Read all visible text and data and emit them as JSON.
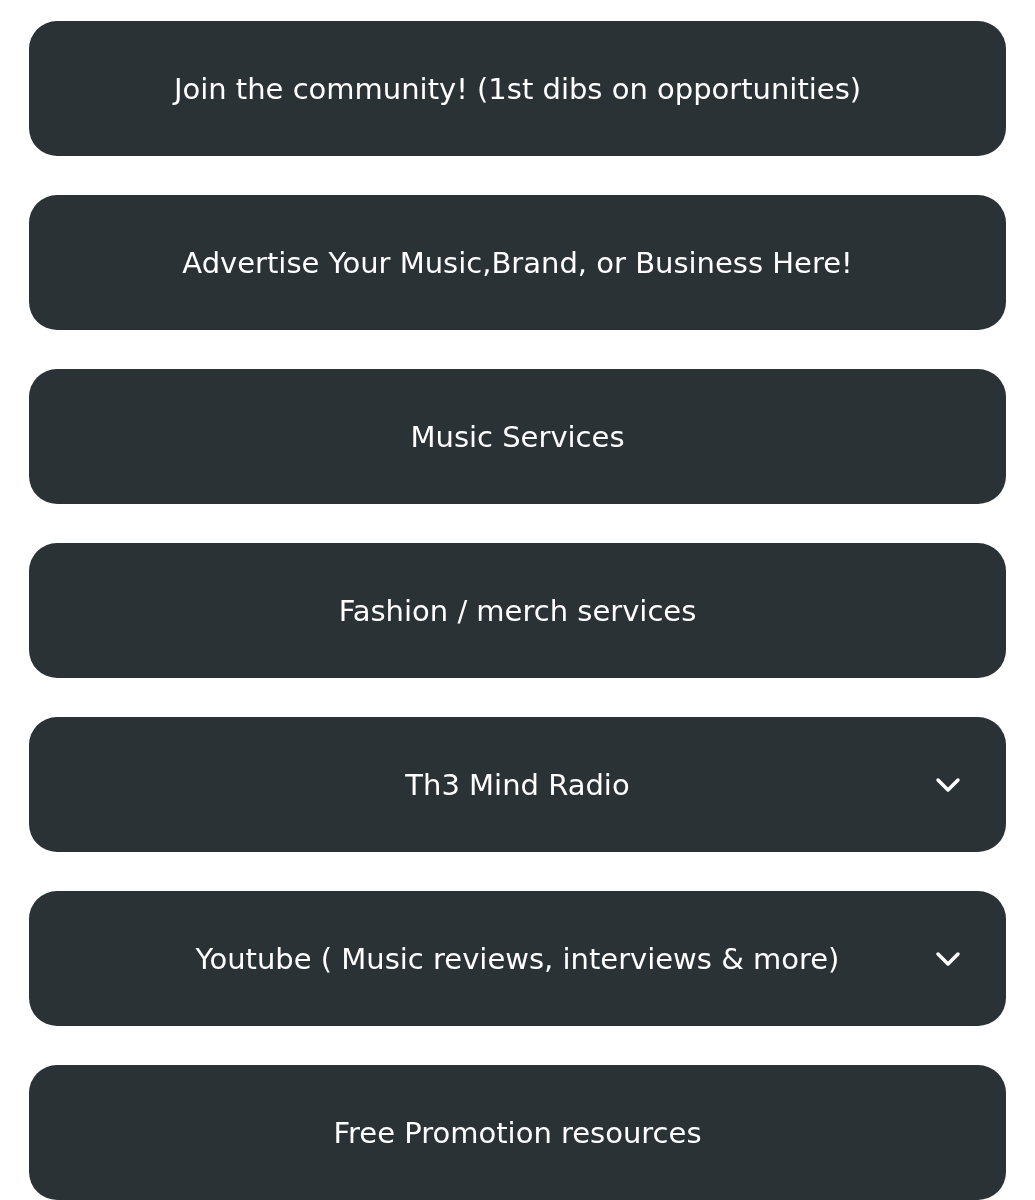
{
  "links": [
    {
      "label": "Join the community! (1st dibs on opportunities)",
      "kind": "link"
    },
    {
      "label": "Advertise Your Music,Brand, or Business Here!",
      "kind": "link"
    },
    {
      "label": "Music Services",
      "kind": "link"
    },
    {
      "label": "Fashion / merch services",
      "kind": "link"
    },
    {
      "label": "Th3 Mind Radio",
      "kind": "dropdown"
    },
    {
      "label": "Youtube ( Music reviews, interviews & more)",
      "kind": "dropdown"
    },
    {
      "label": "Free Promotion resources",
      "kind": "link"
    }
  ]
}
